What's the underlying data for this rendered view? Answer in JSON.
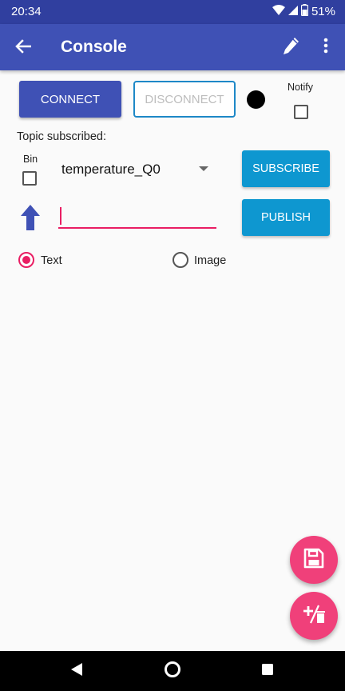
{
  "status_bar": {
    "time": "20:34",
    "battery": "51%",
    "icons": [
      "wifi-icon",
      "signal-icon",
      "battery-icon"
    ]
  },
  "app_bar": {
    "title": "Console",
    "back_icon": "arrow-left-icon",
    "edit_icon": "pencil-icon",
    "menu_icon": "more-vert-icon"
  },
  "connection": {
    "connect_label": "CONNECT",
    "disconnect_label": "DISCONNECT",
    "notify_label": "Notify",
    "notify_checked": false,
    "status_color": "#000000"
  },
  "subscribe": {
    "topic_label": "Topic subscribed:",
    "bin_label": "Bin",
    "bin_checked": false,
    "selected_topic": "temperature_Q0",
    "subscribe_label": "SUBSCRIBE"
  },
  "publish": {
    "message_value": "",
    "publish_label": "PUBLISH"
  },
  "format": {
    "options": [
      {
        "label": "Text",
        "selected": true
      },
      {
        "label": "Image",
        "selected": false
      }
    ]
  },
  "fabs": {
    "save_icon": "save-icon",
    "clear_icon": "add-delete-icon"
  },
  "colors": {
    "primary": "#3f51b5",
    "primary_dark": "#303f9f",
    "accent": "#e91e63",
    "button_blue": "#0e97d0",
    "fab_pink": "#f0407a"
  }
}
